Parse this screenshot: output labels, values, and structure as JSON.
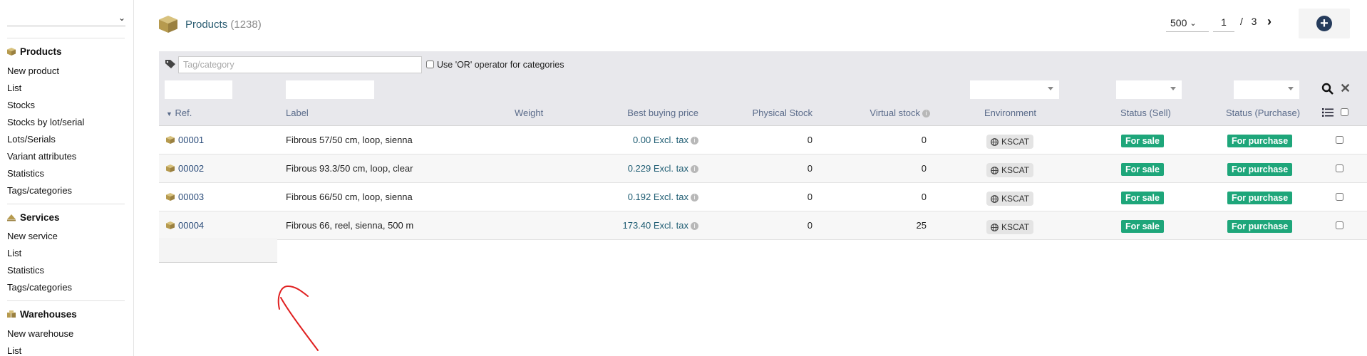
{
  "menu": {
    "sections": [
      {
        "title": "Products",
        "icon": "box-icon",
        "items": [
          "New product",
          "List",
          "Stocks",
          "Stocks by lot/serial",
          "Lots/Serials",
          "Variant attributes",
          "Statistics",
          "Tags/categories"
        ]
      },
      {
        "title": "Services",
        "icon": "service-icon",
        "items": [
          "New service",
          "List",
          "Statistics",
          "Tags/categories"
        ]
      },
      {
        "title": "Warehouses",
        "icon": "warehouse-icon",
        "items": [
          "New warehouse",
          "List"
        ]
      }
    ]
  },
  "header": {
    "title": "Products",
    "count": "(1238)",
    "limit": "500",
    "page": "1",
    "page_sep": "/",
    "total_pages": "3"
  },
  "filters": {
    "tag_placeholder": "Tag/category",
    "or_label": "Use 'OR' operator for categories"
  },
  "columns": {
    "ref": "Ref.",
    "label": "Label",
    "weight": "Weight",
    "best_price": "Best buying price",
    "physical_stock": "Physical Stock",
    "virtual_stock": "Virtual stock",
    "environment": "Environment",
    "status_sell": "Status (Sell)",
    "status_purchase": "Status (Purchase)"
  },
  "rows": [
    {
      "ref": "00001",
      "label": "Fibrous 57/50 cm, loop, sienna",
      "price": "0.00 Excl. tax",
      "physical": "0",
      "virtual": "0",
      "env": "KSCAT",
      "sell": "For sale",
      "purchase": "For purchase"
    },
    {
      "ref": "00002",
      "label": "Fibrous 93.3/50 cm, loop, clear",
      "price": "0.229 Excl. tax",
      "physical": "0",
      "virtual": "0",
      "env": "KSCAT",
      "sell": "For sale",
      "purchase": "For purchase"
    },
    {
      "ref": "00003",
      "label": "Fibrous 66/50 cm, loop, sienna",
      "price": "0.192 Excl. tax",
      "physical": "0",
      "virtual": "0",
      "env": "KSCAT",
      "sell": "For sale",
      "purchase": "For purchase"
    },
    {
      "ref": "00004",
      "label": "Fibrous 66, reel, sienna, 500 m",
      "price": "173.40 Excl. tax",
      "physical": "0",
      "virtual": "25",
      "env": "KSCAT",
      "sell": "For sale",
      "purchase": "For purchase"
    }
  ],
  "colors": {
    "accent": "#2b5d72",
    "status_green": "#1ea67a",
    "box_gold": "#b69a4e",
    "add_button": "#263c5c",
    "annotation_red": "#e02020"
  }
}
